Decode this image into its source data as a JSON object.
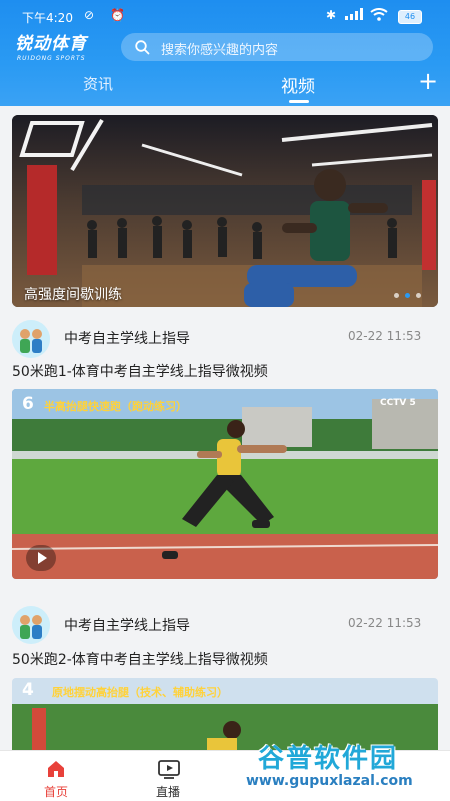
{
  "status_bar": {
    "time": "下午4:20",
    "battery": "46"
  },
  "header": {
    "logo_text": "锐动体育",
    "logo_subtext": "RUIDONG SPORTS",
    "search_placeholder": "搜索你感兴趣的内容",
    "tabs": [
      {
        "label": "资讯",
        "active": false
      },
      {
        "label": "视频",
        "active": true
      }
    ],
    "add_icon": "plus-icon"
  },
  "hero": {
    "caption": "高强度间歇训练",
    "carousel_total": 3,
    "carousel_active": 1
  },
  "feed": [
    {
      "author": "中考自主学线上指导",
      "date": "02-22 11:53",
      "title": "50米跑1-体育中考自主学线上指导微视频",
      "overlay_number": "6",
      "overlay_text": "半高抬腿快速跑（跑动练习）",
      "channel": "CCTV 5"
    },
    {
      "author": "中考自主学线上指导",
      "date": "02-22 11:53",
      "title": "50米跑2-体育中考自主学线上指导微视频",
      "overlay_number": "4",
      "overlay_text": "原地摆动高抬腿（技术、辅助练习）"
    }
  ],
  "bottom_nav": [
    {
      "label": "首页",
      "icon": "home-icon",
      "active": true
    },
    {
      "label": "直播",
      "icon": "tv-icon",
      "active": false
    }
  ],
  "watermark": {
    "name": "谷普软件园",
    "url": "www.gupuxlazal.com"
  },
  "colors": {
    "brand_blue": "#2a9af3",
    "active_red": "#e8413a",
    "text": "#222222"
  }
}
